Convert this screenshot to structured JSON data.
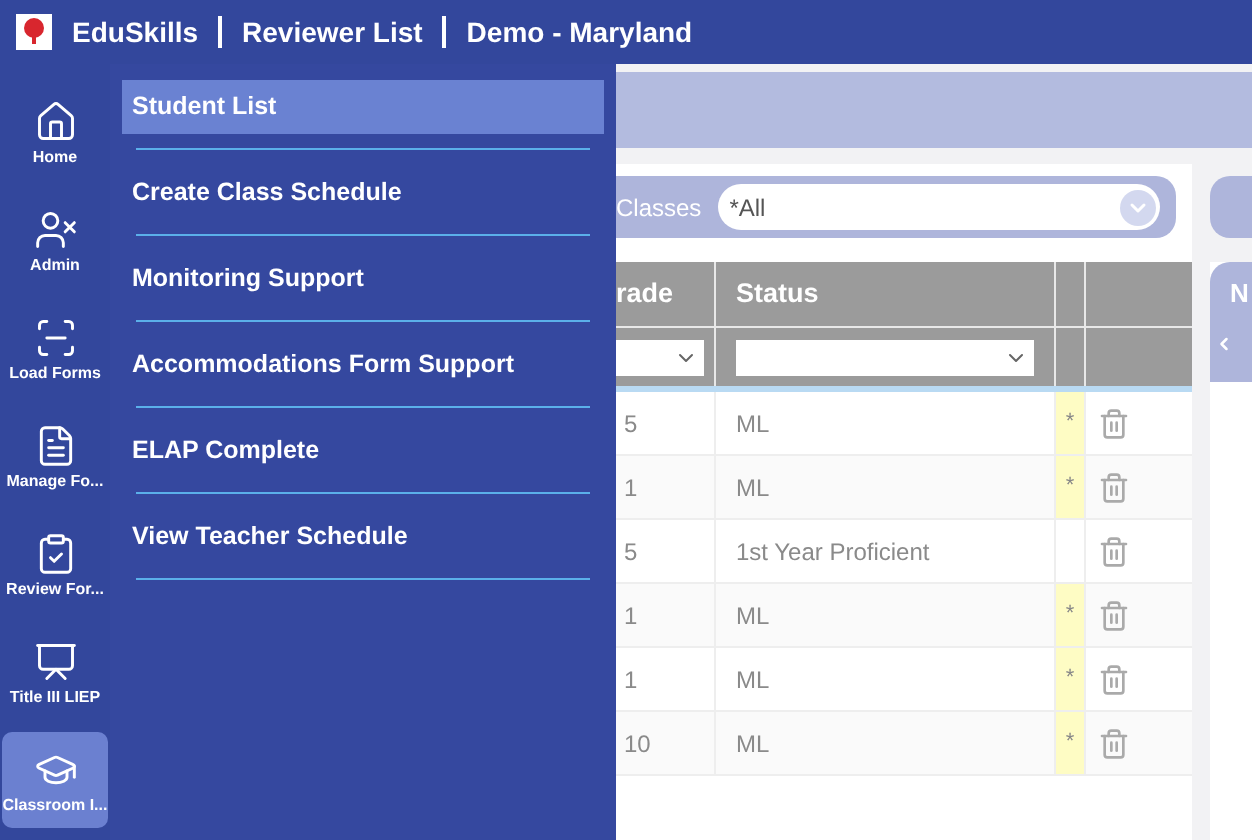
{
  "header": {
    "brand": "EduSkills",
    "items": [
      "Reviewer List",
      "Demo - Maryland"
    ]
  },
  "rail": [
    {
      "label": "Home",
      "selected": false
    },
    {
      "label": "Admin",
      "selected": false
    },
    {
      "label": "Load Forms",
      "selected": false
    },
    {
      "label": "Manage Fo...",
      "selected": false
    },
    {
      "label": "Review For...",
      "selected": false
    },
    {
      "label": "Title III LIEP",
      "selected": false
    },
    {
      "label": "Classroom I...",
      "selected": true
    }
  ],
  "menu": [
    {
      "label": "Student List",
      "selected": true
    },
    {
      "label": "Create Class Schedule",
      "selected": false
    },
    {
      "label": "Monitoring Support",
      "selected": false
    },
    {
      "label": "Accommodations Form Support",
      "selected": false
    },
    {
      "label": "ELAP Complete",
      "selected": false
    },
    {
      "label": "View Teacher Schedule",
      "selected": false
    }
  ],
  "filter": {
    "label": "Classes",
    "value": "*All"
  },
  "table": {
    "columns": [
      "rade",
      "Status"
    ],
    "rows": [
      {
        "grade": "5",
        "status": "ML",
        "flag": "*"
      },
      {
        "grade": "1",
        "status": "ML",
        "flag": "*"
      },
      {
        "grade": "5",
        "status": "1st Year Proficient"
      },
      {
        "grade": "1",
        "status": "ML",
        "flag": "*"
      },
      {
        "grade": "1",
        "status": "ML",
        "flag": "*"
      },
      {
        "grade": "10",
        "status": "ML",
        "flag": "*"
      }
    ]
  },
  "side_panel": {
    "heading": "N"
  }
}
